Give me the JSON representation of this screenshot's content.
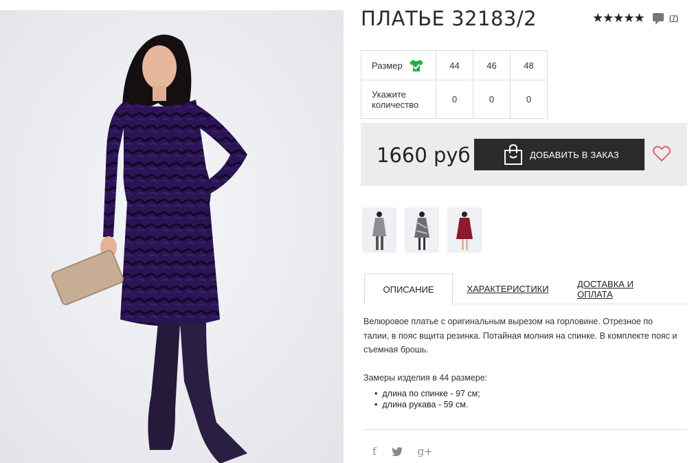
{
  "product": {
    "title": "ПЛАТЬЕ 32183/2",
    "stars": "★★★★★",
    "review_count": "(7)"
  },
  "sizes": {
    "size_label": "Размер",
    "qty_label": "Укажите количество",
    "values": [
      "44",
      "46",
      "48"
    ],
    "quantities": [
      "0",
      "0",
      "0"
    ]
  },
  "purchase": {
    "price": "1660 руб",
    "add_button": "ДОБАВИТЬ В ЗАКАЗ"
  },
  "tabs": [
    {
      "label": "ОПИСАНИЕ",
      "active": true
    },
    {
      "label": "ХАРАКТЕРИСТИКИ",
      "active": false
    },
    {
      "label": "ДОСТАВКА И ОПЛАТА",
      "active": false
    }
  ],
  "description": {
    "text": "Велюровое платье с оригинальным вырезом на горловине. Отрезное по талии, в пояс вщита резинка. Потайная молния на спинке. В комплекте пояс и съемная брошь.",
    "measure_title": "Замеры изделия в 44 размере:",
    "measures": [
      "длина по спинке - 97 см;",
      "длина рукава - 59 см."
    ]
  },
  "social": {
    "facebook": "f",
    "twitter": "🐦",
    "gplus": "g+"
  },
  "colors": {
    "dress_main": "#2a1450",
    "button_bg": "#2b2b2b",
    "price_bg": "#ececec",
    "heart": "#e0607e",
    "size_icon": "#22b14c"
  },
  "icons": [
    "comment-icon",
    "size-chart-icon",
    "shopping-bag-icon",
    "heart-icon",
    "facebook-icon",
    "twitter-icon",
    "google-plus-icon"
  ]
}
